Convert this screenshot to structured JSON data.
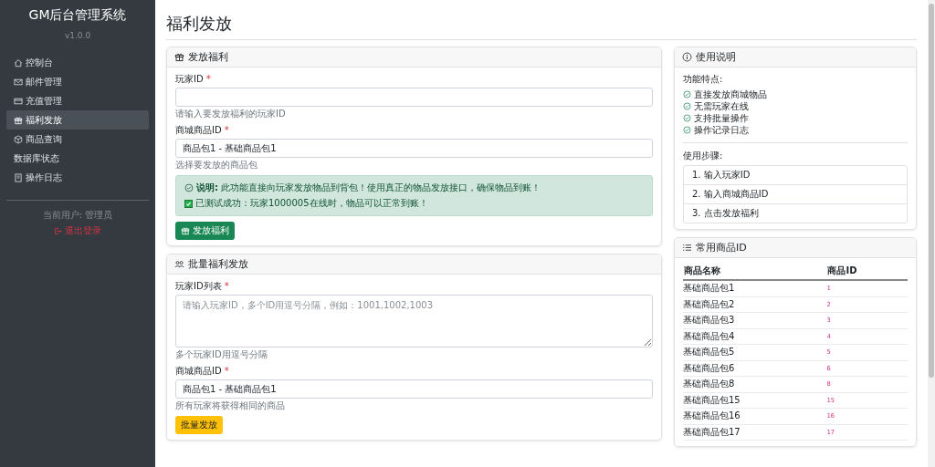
{
  "sidebar": {
    "title": "GM后台管理系统",
    "version": "v1.0.0",
    "items": [
      {
        "label": "控制台",
        "selected": false
      },
      {
        "label": "邮件管理",
        "selected": false
      },
      {
        "label": "充值管理",
        "selected": false
      },
      {
        "label": "福利发放",
        "selected": true
      },
      {
        "label": "商品查询",
        "selected": false
      },
      {
        "label": "数据库状态",
        "selected": false
      },
      {
        "label": "操作日志",
        "selected": false
      }
    ],
    "current_user": "当前用户: 管理员",
    "logout": "退出登录"
  },
  "page_title": "福利发放",
  "grant_card": {
    "title": "发放福利",
    "fields": [
      {
        "label": "玩家ID",
        "required": "*",
        "help": "请输入要发放福利的玩家ID"
      },
      {
        "label": "商城商品ID",
        "required": "*",
        "value": "商品包1 - 基础商品包1",
        "help": "选择要发放的商品包"
      }
    ],
    "alert": {
      "text": "**说明:** 此功能直接向玩家发放物品到背包！使用真正的物品发放接口，确保物品到账！",
      "check_text": "已测试成功：玩家1000005在线时，物品可以正常到账！",
      "checked": true
    },
    "button": "发放福利"
  },
  "batch_card": {
    "title": "批量福利发放",
    "list_label": "玩家ID列表",
    "list_required": "*",
    "list_placeholder": "请输入玩家ID，多个ID用逗号分隔，例如：1001,1002,1003",
    "list_help": "多个玩家ID用逗号分隔",
    "item_label": "商城商品ID",
    "item_required": "*",
    "item_value": "商品包1 - 基础商品包1",
    "item_help": "所有玩家将获得相同的商品",
    "button": "批量发放"
  },
  "help_card": {
    "title": "使用说明",
    "features_title": "功能特点:",
    "features": [
      "直接发放商城物品",
      "无需玩家在线",
      "支持批量操作",
      "操作记录日志"
    ],
    "steps_title": "使用步骤:",
    "steps": [
      "1. 输入玩家ID",
      "2. 输入商城商品ID",
      "3. 点击发放福利"
    ]
  },
  "items_card": {
    "title": "常用商品ID",
    "columns": [
      "商品名称",
      "商品ID"
    ],
    "rows": [
      [
        "基础商品包1",
        "1"
      ],
      [
        "基础商品包2",
        "2"
      ],
      [
        "基础商品包3",
        "3"
      ],
      [
        "基础商品包4",
        "4"
      ],
      [
        "基础商品包5",
        "5"
      ],
      [
        "基础商品包6",
        "6"
      ],
      [
        "基础商品包8",
        "8"
      ],
      [
        "基础商品包15",
        "15"
      ],
      [
        "基础商品包16",
        "16"
      ],
      [
        "基础商品包17",
        "17"
      ]
    ]
  }
}
